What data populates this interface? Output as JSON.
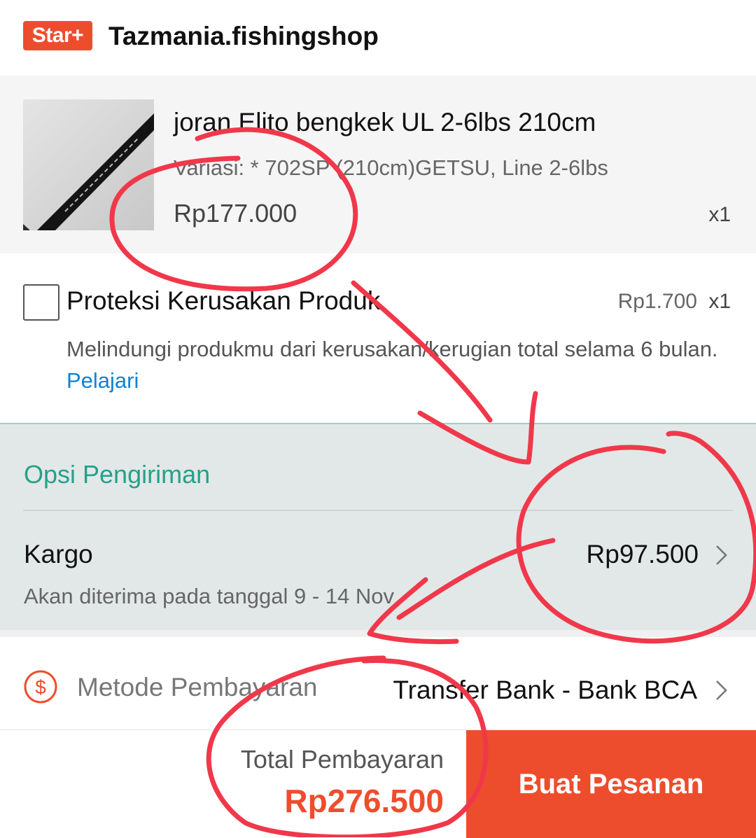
{
  "shop": {
    "badge": "Star+",
    "name": "Tazmania.fishingshop"
  },
  "product": {
    "name": "joran Elito bengkek UL 2-6lbs 210cm",
    "variant": "Variasi: * 702SP (210cm)GETSU, Line 2-6lbs",
    "price": "Rp177.000",
    "quantity": "x1"
  },
  "protection": {
    "title": "Proteksi Kerusakan Produk",
    "price": "Rp1.700",
    "quantity": "x1",
    "description": "Melindungi produkmu dari kerusakan/kerugian total selama 6 bulan.",
    "link": "Pelajari",
    "checked": false
  },
  "shipping": {
    "heading": "Opsi Pengiriman",
    "method": "Kargo",
    "price": "Rp97.500",
    "eta": "Akan diterima pada tanggal 9 - 14 Nov"
  },
  "payment": {
    "label": "Metode Pembayaran",
    "icon": "dollar-circle-icon",
    "value": "Transfer Bank - Bank BCA"
  },
  "footer": {
    "total_label": "Total Pembayaran",
    "total_value": "Rp276.500",
    "order_button": "Buat Pesanan"
  },
  "colors": {
    "brand": "#ee4d2d",
    "shipping_accent": "#26a08a",
    "link": "#0a83d6",
    "annotation_marker": "#f0384a"
  }
}
